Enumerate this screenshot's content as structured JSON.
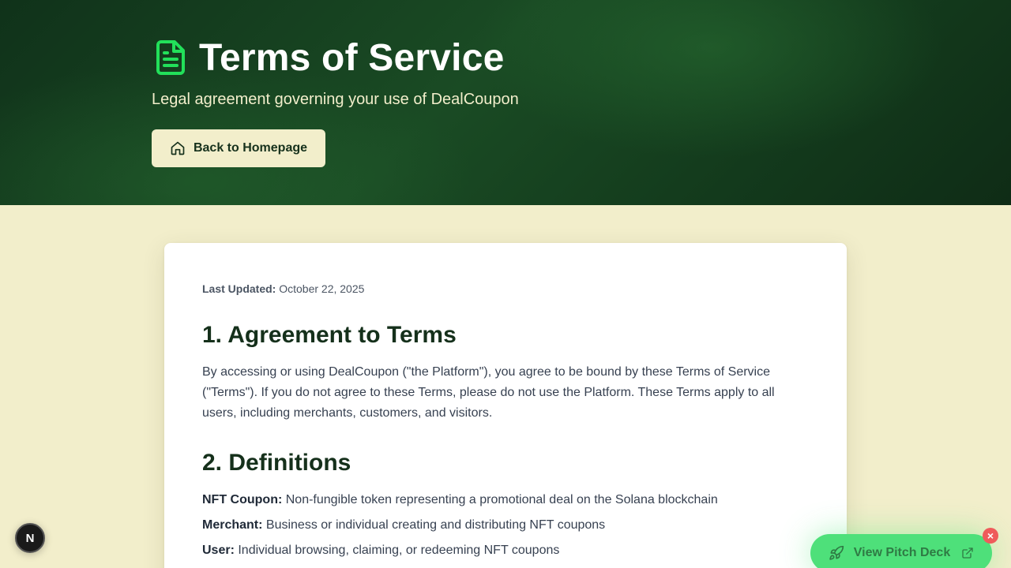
{
  "header": {
    "title": "Terms of Service",
    "subtitle": "Legal agreement governing your use of DealCoupon",
    "back_button": "Back to Homepage",
    "title_icon": "file-text-icon",
    "back_icon": "home-icon"
  },
  "content": {
    "last_updated_label": "Last Updated:",
    "last_updated_value": "October 22, 2025",
    "section1_title": "1. Agreement to Terms",
    "section1_text": "By accessing or using DealCoupon (\"the Platform\"), you agree to be bound by these Terms of Service (\"Terms\"). If you do not agree to these Terms, please do not use the Platform. These Terms apply to all users, including merchants, customers, and visitors.",
    "section2_title": "2. Definitions",
    "definitions": [
      {
        "term": "NFT Coupon:",
        "text": "Non-fungible token representing a promotional deal on the Solana blockchain"
      },
      {
        "term": "Merchant:",
        "text": "Business or individual creating and distributing NFT coupons"
      },
      {
        "term": "User:",
        "text": "Individual browsing, claiming, or redeeming NFT coupons"
      }
    ]
  },
  "floating": {
    "dev_badge": "N",
    "pitch_button": "View Pitch Deck",
    "pitch_icon": "rocket-icon",
    "external_icon": "external-link-icon",
    "close_label": "×"
  },
  "colors": {
    "hero_dark": "#10321a",
    "accent_green": "#22e05a",
    "page_bg": "#f2eecb",
    "heading": "#15301b",
    "pitch_bg": "#4ee07a",
    "close_red": "#ef5b5b"
  }
}
